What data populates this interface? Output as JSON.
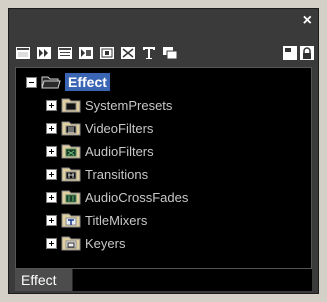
{
  "window": {
    "close_label": "×"
  },
  "toolbar": {
    "buttons": [
      {
        "name": "view-large-icon"
      },
      {
        "name": "view-small-icon"
      },
      {
        "name": "view-list-icon"
      },
      {
        "name": "view-details-icon"
      },
      {
        "name": "expand-icon"
      },
      {
        "name": "collapse-icon"
      },
      {
        "name": "title-icon"
      },
      {
        "name": "window-icon"
      },
      {
        "name": "new-folder-icon"
      },
      {
        "name": "lock-icon"
      }
    ]
  },
  "tree": {
    "root": {
      "label": "Effect"
    },
    "children": [
      {
        "label": "SystemPresets",
        "icon": "system-presets-icon"
      },
      {
        "label": "VideoFilters",
        "icon": "video-filters-icon"
      },
      {
        "label": "AudioFilters",
        "icon": "audio-filters-icon"
      },
      {
        "label": "Transitions",
        "icon": "transitions-icon"
      },
      {
        "label": "AudioCrossFades",
        "icon": "audio-crossfades-icon"
      },
      {
        "label": "TitleMixers",
        "icon": "title-mixers-icon"
      },
      {
        "label": "Keyers",
        "icon": "keyers-icon"
      }
    ]
  },
  "tabs": [
    {
      "label": "Effect"
    }
  ],
  "colors": {
    "panel_bg": "#3a3a3a",
    "tree_bg": "#000000",
    "selection": "#3a64b4",
    "text": "#c8c8c8"
  }
}
